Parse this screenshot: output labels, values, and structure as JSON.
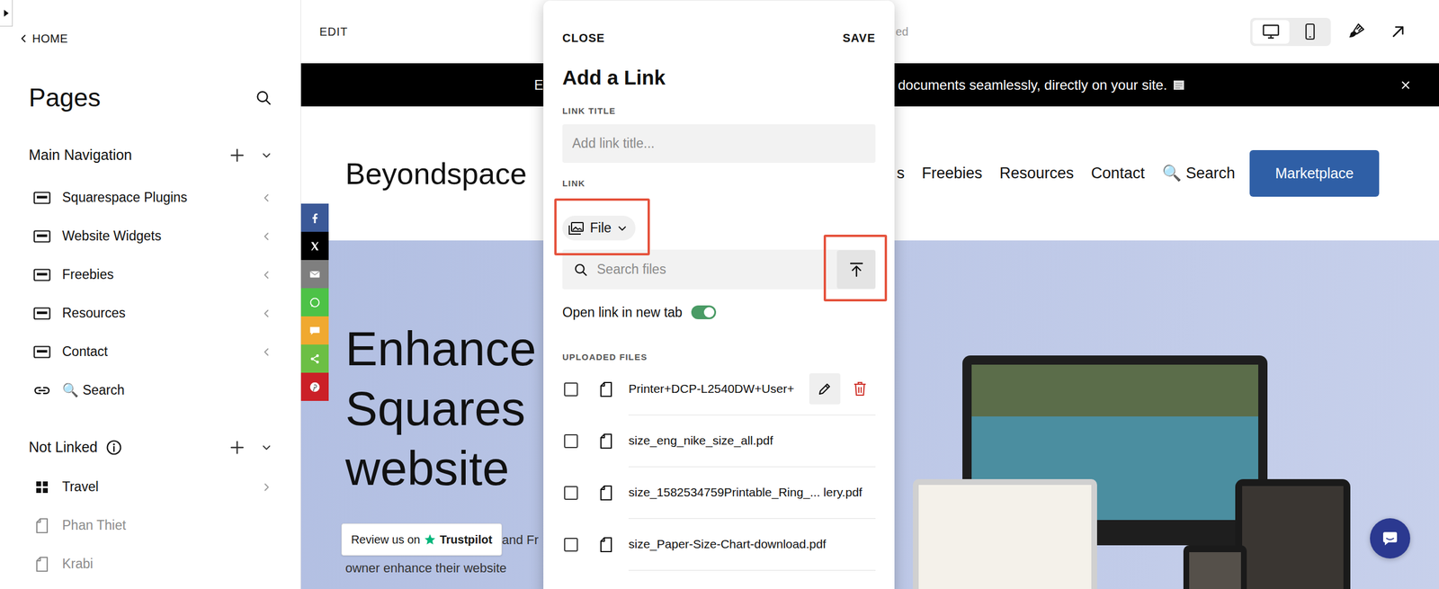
{
  "sidebar": {
    "back": "HOME",
    "title": "Pages",
    "sections": [
      {
        "title": "Main Navigation",
        "info": false,
        "expanded": true,
        "items": [
          {
            "label": "Squarespace Plugins",
            "kind": "folder",
            "disabled": false
          },
          {
            "label": "Website Widgets",
            "kind": "folder",
            "disabled": false
          },
          {
            "label": "Freebies",
            "kind": "folder",
            "disabled": false
          },
          {
            "label": "Resources",
            "kind": "folder",
            "disabled": false
          },
          {
            "label": "Contact",
            "kind": "folder",
            "disabled": false
          },
          {
            "label": "🔍 Search",
            "kind": "link",
            "disabled": false
          }
        ]
      },
      {
        "title": "Not Linked",
        "info": true,
        "expanded": true,
        "items": [
          {
            "label": "Travel",
            "kind": "index",
            "disabled": false
          },
          {
            "label": "Phan Thiet",
            "kind": "page",
            "disabled": true
          },
          {
            "label": "Krabi",
            "kind": "page",
            "disabled": true
          }
        ]
      }
    ]
  },
  "editor": {
    "mode": "EDIT",
    "status": "ed",
    "devices": [
      {
        "kind": "desktop",
        "selected": true
      },
      {
        "kind": "mobile",
        "selected": false
      }
    ]
  },
  "site": {
    "banner": {
      "left": "E",
      "right": "documents seamlessly, directly on your site."
    },
    "logo": "Beyondspace",
    "nav": [
      "s",
      "Freebies",
      "Resources",
      "Contact",
      "🔍 Search"
    ],
    "cta": "Marketplace",
    "share": [
      {
        "kind": "facebook",
        "color": "#3b5998"
      },
      {
        "kind": "x",
        "color": "#000000"
      },
      {
        "kind": "email",
        "color": "#7f7f7f"
      },
      {
        "kind": "whatsapp",
        "color": "#4dc247"
      },
      {
        "kind": "sms",
        "color": "#f0a930"
      },
      {
        "kind": "share",
        "color": "#6cbf44"
      },
      {
        "kind": "pinterest",
        "color": "#cb2027"
      }
    ],
    "hero": {
      "lines": [
        "Enhance",
        "Squares",
        "website"
      ],
      "badge": {
        "prefix": "Review us on",
        "brand": "Trustpilot"
      },
      "para": [
        "and Fr",
        "owner enhance their website"
      ]
    }
  },
  "dialog": {
    "close": "CLOSE",
    "save": "SAVE",
    "title": "Add a Link",
    "title_field": {
      "label": "LINK TITLE",
      "placeholder": "Add link title..."
    },
    "link": {
      "label": "LINK",
      "type": "File"
    },
    "search": {
      "placeholder": "Search files"
    },
    "new_tab": {
      "label": "Open link in new tab",
      "on": true
    },
    "files_label": "UPLOADED FILES",
    "files": [
      {
        "name": "Printer+DCP-L2540DW+User+",
        "checked": false,
        "hovered": true
      },
      {
        "name": "size_eng_nike_size_all.pdf",
        "checked": false,
        "hovered": false
      },
      {
        "name": "size_1582534759Printable_Ring_... lery.pdf",
        "checked": false,
        "hovered": false
      },
      {
        "name": "size_Paper-Size-Chart-download.pdf",
        "checked": false,
        "hovered": false
      }
    ]
  }
}
